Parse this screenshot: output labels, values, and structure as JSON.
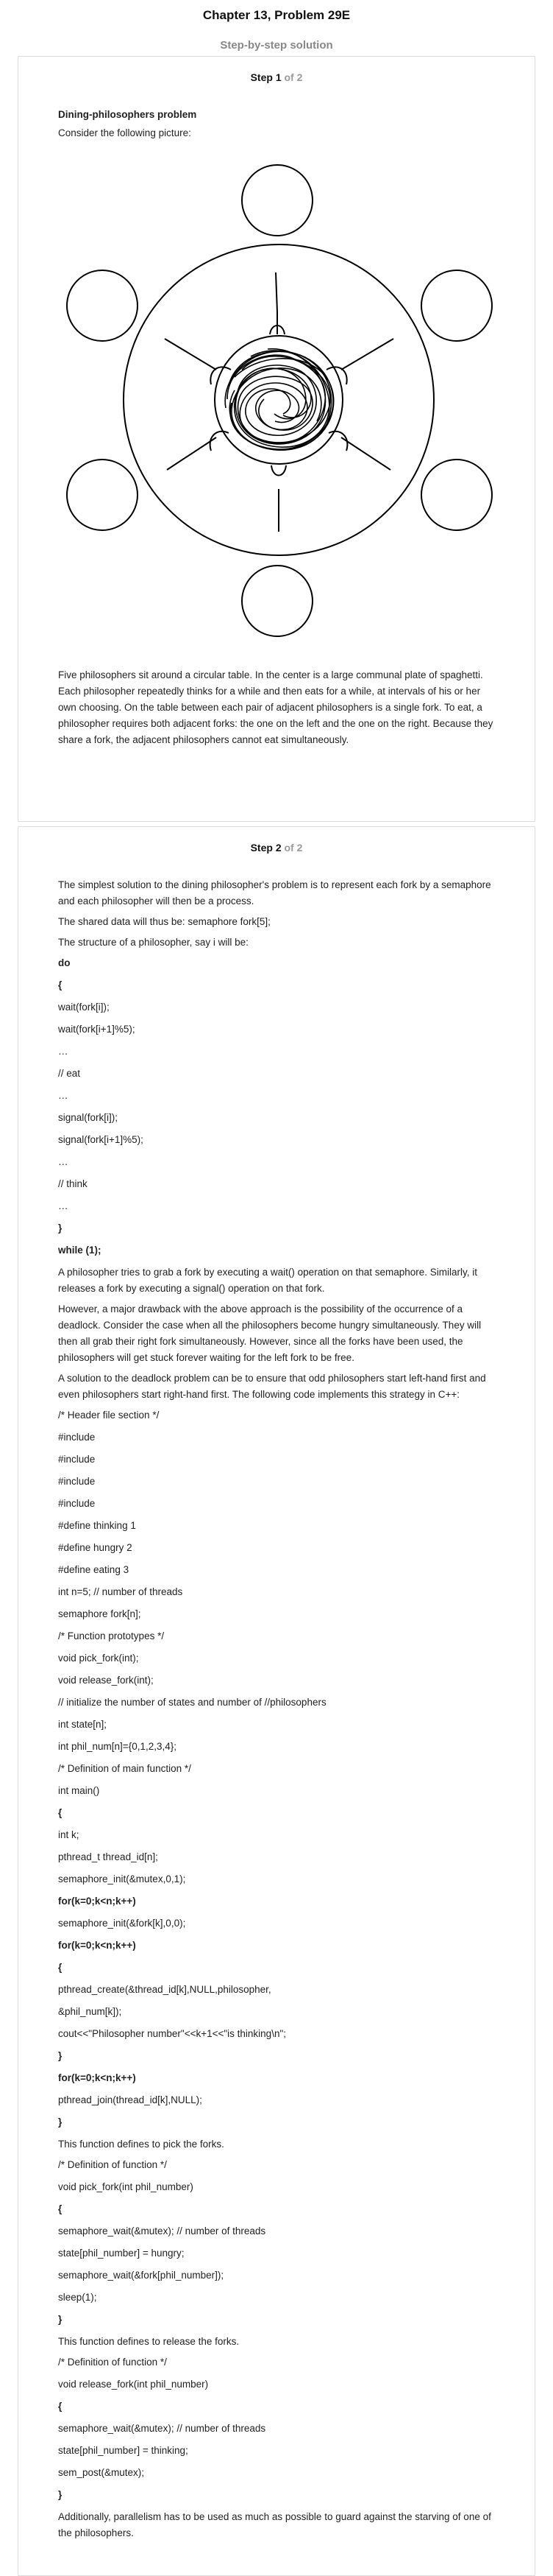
{
  "header": {
    "title": "Chapter 13, Problem 29E",
    "subtitle": "Step-by-step solution"
  },
  "step1": {
    "label": "Step 1",
    "of": "of 2",
    "heading": "Dining-philosophers problem",
    "intro": "Consider the following picture:",
    "body": "Five philosophers sit around a circular table. In the center is a large communal plate of spaghetti. Each philosopher repeatedly thinks for a while and then eats for a while, at intervals of his or her own choosing. On the table between each pair of adjacent philosophers is a single fork. To eat, a philosopher requires both adjacent forks: the one on the left and the one on the right. Because they share a fork, the adjacent philosophers cannot eat simultaneously."
  },
  "step2": {
    "label": "Step 2",
    "of": "of 2",
    "p1": "The simplest solution to the dining philosopher's problem is to represent each fork by a semaphore and each philosopher will then be a process.",
    "p2": "The shared data will thus be: semaphore fork[5];",
    "p3": "The structure of a philosopher, say i will be:",
    "code1": [
      "do",
      "{",
      "wait(fork[i]);",
      "wait(fork[i+1]%5);",
      "…",
      "// eat",
      "…",
      "signal(fork[i]);",
      "signal(fork[i+1]%5);",
      "…",
      "// think",
      "…",
      "}",
      "while (1);"
    ],
    "p4": "A philosopher tries to grab a fork by executing a wait() operation on that semaphore. Similarly, it releases a fork by executing a signal() operation on that fork.",
    "p5": "However, a major drawback with the above approach is the possibility of the occurrence of a deadlock. Consider the case when all the philosophers become hungry simultaneously. They will then all grab their right fork simultaneously. However, since all the forks have been used, the philosophers will get stuck forever waiting for the left fork to be free.",
    "p6": "A solution to the deadlock problem can be to ensure that odd philosophers start left-hand first and even philosophers start right-hand first. The following code implements this strategy in C++:",
    "code2": [
      "/* Header file section */",
      "#include",
      "#include",
      "#include",
      "#include",
      "#define thinking 1",
      "#define hungry 2",
      "#define eating 3",
      "int n=5; // number of threads",
      "semaphore fork[n];",
      "/* Function prototypes */",
      "void pick_fork(int);",
      "void release_fork(int);",
      "// initialize the number of states and number of //philosophers",
      "int state[n];",
      "int phil_num[n]={0,1,2,3,4};",
      "/* Definition of main function */",
      "int main()",
      "{",
      "int k;",
      "pthread_t thread_id[n];",
      "semaphore_init(&mutex,0,1);",
      "for(k=0;k<n;k++)",
      "semaphore_init(&fork[k],0,0);",
      "for(k=0;k<n;k++)",
      "{",
      "pthread_create(&thread_id[k],NULL,philosopher,",
      "&phil_num[k]);",
      "cout<<\"Philosopher number\"<<k+1<<\"is thinking\\n\";",
      "}",
      "for(k=0;k<n;k++)",
      "pthread_join(thread_id[k],NULL);",
      "}"
    ],
    "p7": "This function defines to pick the forks.",
    "code3": [
      "/* Definition of function */",
      "void pick_fork(int phil_number)",
      "{",
      "semaphore_wait(&mutex); // number of threads",
      "state[phil_number] = hungry;",
      "semaphore_wait(&fork[phil_number]);",
      "sleep(1);",
      "}"
    ],
    "p8": "This function defines to release the forks.",
    "code4": [
      "/* Definition of function */",
      "void release_fork(int phil_number)",
      "{",
      "semaphore_wait(&mutex); // number of threads",
      "state[phil_number] = thinking;",
      "sem_post(&mutex);",
      "}"
    ],
    "p9": "Additionally, parallelism has to be used as much as possible to guard against the starving of one of the philosophers."
  }
}
